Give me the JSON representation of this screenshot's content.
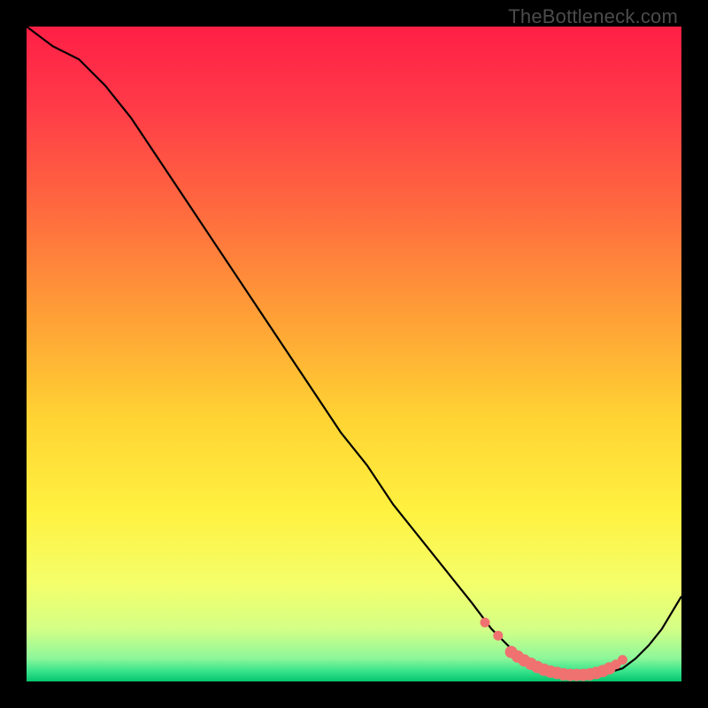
{
  "watermark": "TheBottleneck.com",
  "colors": {
    "stroke": "#000000",
    "marker": "#ef7270",
    "bg_black": "#000000"
  },
  "chart_data": {
    "type": "line",
    "title": "",
    "xlabel": "",
    "ylabel": "",
    "xlim": [
      0,
      100
    ],
    "ylim": [
      0,
      100
    ],
    "grid": false,
    "series": [
      {
        "name": "curve",
        "x": [
          0,
          4,
          8,
          12,
          16,
          20,
          24,
          28,
          32,
          36,
          40,
          44,
          48,
          52,
          56,
          60,
          64,
          68,
          71,
          73,
          75,
          77,
          79,
          81,
          83,
          85,
          87,
          89,
          91,
          93,
          95,
          97,
          100
        ],
        "y": [
          100,
          97,
          95,
          91,
          86,
          80,
          74,
          68,
          62,
          56,
          50,
          44,
          38,
          33,
          27,
          22,
          17,
          12,
          8,
          6,
          4,
          3,
          2,
          1.3,
          1,
          1,
          1,
          1.4,
          2,
          3.5,
          5.5,
          8,
          13
        ]
      }
    ],
    "markers": {
      "name": "highlight-points",
      "x": [
        70,
        72,
        74,
        75,
        76,
        77,
        78,
        79,
        80,
        81,
        82,
        83,
        84,
        85,
        86,
        87,
        88,
        89,
        90,
        91
      ],
      "y": [
        9,
        7,
        4.5,
        3.8,
        3.2,
        2.7,
        2.2,
        1.8,
        1.5,
        1.3,
        1.1,
        1.0,
        1.0,
        1.0,
        1.1,
        1.3,
        1.6,
        2.0,
        2.6,
        3.3
      ]
    },
    "gradient_stops": [
      {
        "offset": 0.0,
        "color": "#ff1f46"
      },
      {
        "offset": 0.12,
        "color": "#ff3a48"
      },
      {
        "offset": 0.28,
        "color": "#ff6a3f"
      },
      {
        "offset": 0.45,
        "color": "#ffa236"
      },
      {
        "offset": 0.6,
        "color": "#ffd433"
      },
      {
        "offset": 0.74,
        "color": "#fff140"
      },
      {
        "offset": 0.85,
        "color": "#f4ff6a"
      },
      {
        "offset": 0.92,
        "color": "#d4ff86"
      },
      {
        "offset": 0.965,
        "color": "#8cf79a"
      },
      {
        "offset": 0.985,
        "color": "#35e28a"
      },
      {
        "offset": 1.0,
        "color": "#06c46e"
      }
    ]
  }
}
